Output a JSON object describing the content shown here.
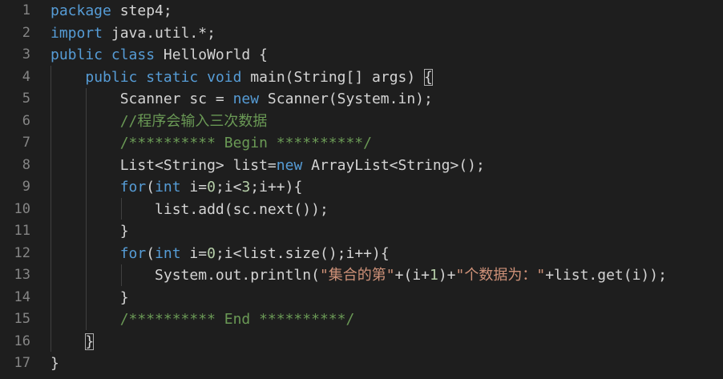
{
  "editor": {
    "language": "java",
    "colors": {
      "background": "#1e1e1e",
      "line_number": "#858585",
      "keyword": "#569cd6",
      "number": "#b5cea8",
      "string": "#ce9178",
      "comment": "#6a9955",
      "text": "#d4d4d4"
    },
    "lines": [
      {
        "n": "1",
        "tokens": [
          {
            "t": "package",
            "c": "kw"
          },
          {
            "t": " step4;",
            "c": "plain"
          }
        ]
      },
      {
        "n": "2",
        "tokens": [
          {
            "t": "import",
            "c": "kw"
          },
          {
            "t": " java.util.*;",
            "c": "plain"
          }
        ]
      },
      {
        "n": "3",
        "tokens": [
          {
            "t": "public",
            "c": "kw"
          },
          {
            "t": " ",
            "c": "plain"
          },
          {
            "t": "class",
            "c": "kw"
          },
          {
            "t": " HelloWorld {",
            "c": "plain"
          }
        ]
      },
      {
        "n": "4",
        "tokens": [
          {
            "t": "    ",
            "c": "plain"
          },
          {
            "t": "public",
            "c": "kw"
          },
          {
            "t": " ",
            "c": "plain"
          },
          {
            "t": "static",
            "c": "kw"
          },
          {
            "t": " ",
            "c": "plain"
          },
          {
            "t": "void",
            "c": "kw"
          },
          {
            "t": " main(String[] args) ",
            "c": "plain"
          },
          {
            "t": "{",
            "c": "plain",
            "box": true
          }
        ]
      },
      {
        "n": "5",
        "tokens": [
          {
            "t": "        Scanner sc = ",
            "c": "plain"
          },
          {
            "t": "new",
            "c": "kw"
          },
          {
            "t": " Scanner(System.in);",
            "c": "plain"
          }
        ]
      },
      {
        "n": "6",
        "tokens": [
          {
            "t": "        //程序会输入三次数据",
            "c": "cmt"
          }
        ]
      },
      {
        "n": "7",
        "tokens": [
          {
            "t": "        /********** Begin **********/",
            "c": "cmt"
          }
        ]
      },
      {
        "n": "8",
        "tokens": [
          {
            "t": "        List<String> list=",
            "c": "plain"
          },
          {
            "t": "new",
            "c": "kw"
          },
          {
            "t": " ArrayList<String>();",
            "c": "plain"
          }
        ]
      },
      {
        "n": "9",
        "tokens": [
          {
            "t": "        ",
            "c": "plain"
          },
          {
            "t": "for",
            "c": "kw"
          },
          {
            "t": "(",
            "c": "plain"
          },
          {
            "t": "int",
            "c": "kw"
          },
          {
            "t": " i=",
            "c": "plain"
          },
          {
            "t": "0",
            "c": "num"
          },
          {
            "t": ";i<",
            "c": "plain"
          },
          {
            "t": "3",
            "c": "num"
          },
          {
            "t": ";i++){",
            "c": "plain"
          }
        ]
      },
      {
        "n": "10",
        "tokens": [
          {
            "t": "            list.add(sc.next());",
            "c": "plain"
          }
        ]
      },
      {
        "n": "11",
        "tokens": [
          {
            "t": "        }",
            "c": "plain"
          }
        ]
      },
      {
        "n": "12",
        "tokens": [
          {
            "t": "        ",
            "c": "plain"
          },
          {
            "t": "for",
            "c": "kw"
          },
          {
            "t": "(",
            "c": "plain"
          },
          {
            "t": "int",
            "c": "kw"
          },
          {
            "t": " i=",
            "c": "plain"
          },
          {
            "t": "0",
            "c": "num"
          },
          {
            "t": ";i<list.size();i++){",
            "c": "plain"
          }
        ]
      },
      {
        "n": "13",
        "tokens": [
          {
            "t": "            System.out.println(",
            "c": "plain"
          },
          {
            "t": "\"集合的第\"",
            "c": "str"
          },
          {
            "t": "+(i+",
            "c": "plain"
          },
          {
            "t": "1",
            "c": "num"
          },
          {
            "t": ")+",
            "c": "plain"
          },
          {
            "t": "\"个数据为：\"",
            "c": "str"
          },
          {
            "t": "+list.get(i));",
            "c": "plain"
          }
        ]
      },
      {
        "n": "14",
        "tokens": [
          {
            "t": "        }",
            "c": "plain"
          }
        ]
      },
      {
        "n": "15",
        "tokens": [
          {
            "t": "        /********** End **********/",
            "c": "cmt"
          }
        ]
      },
      {
        "n": "16",
        "tokens": [
          {
            "t": "    ",
            "c": "plain"
          },
          {
            "t": "}",
            "c": "plain",
            "box": true
          }
        ]
      },
      {
        "n": "17",
        "tokens": [
          {
            "t": "}",
            "c": "plain"
          }
        ]
      }
    ]
  }
}
